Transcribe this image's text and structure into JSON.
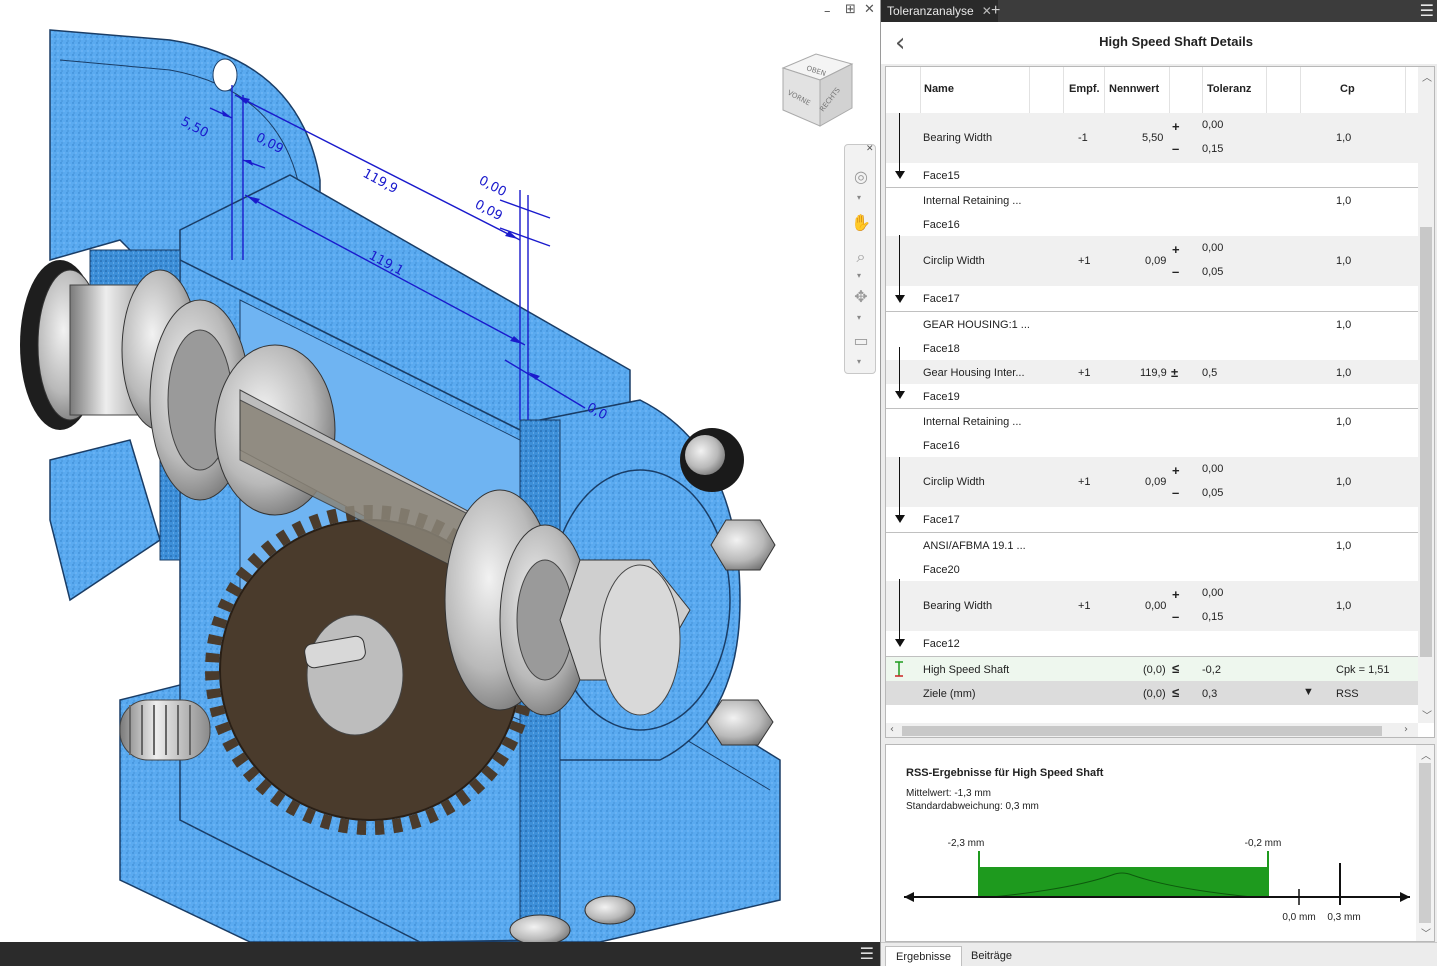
{
  "viewport": {
    "dimensions": [
      {
        "value": "5,50"
      },
      {
        "value": "0,09"
      },
      {
        "value": "119,9"
      },
      {
        "value": "119,1"
      },
      {
        "value": "0,00"
      },
      {
        "value": "0,09"
      },
      {
        "value": "0,0"
      }
    ],
    "viewcube": {
      "top": "OBEN",
      "front": "VORNE",
      "right": "RECHTS"
    },
    "nav_icons": [
      "steering-wheel-icon",
      "pan-icon",
      "zoom-icon",
      "orbit-icon",
      "look-at-icon"
    ],
    "colors": {
      "housing": "#5aaaf0",
      "housing_dark": "#2f7ec8",
      "dimension": "#1a1acc",
      "gear": "#5a4a3a",
      "metal": "#bfbfbf"
    }
  },
  "panel": {
    "tab_label": "Toleranzanalyse",
    "tab_close": "✕",
    "tab_add": "+",
    "title": "High Speed Shaft Details",
    "columns": {
      "name": "Name",
      "empf": "Empf.",
      "nennwert": "Nennwert",
      "toleranz": "Toleranz",
      "cp": "Cp"
    },
    "rows": [
      {
        "name": "Bearing Width",
        "empf": "-1",
        "nennwert": "5,50",
        "sym": "+/-",
        "tol_upper": "0,00",
        "tol_lower": "0,15",
        "cp": "1,0"
      },
      {
        "name": "Face15"
      },
      {
        "name": "Internal Retaining ...",
        "cp": "1,0"
      },
      {
        "name": "Face16"
      },
      {
        "name": "Circlip Width",
        "empf": "+1",
        "nennwert": "0,09",
        "sym": "+/-",
        "tol_upper": "0,00",
        "tol_lower": "0,05",
        "cp": "1,0"
      },
      {
        "name": "Face17"
      },
      {
        "name": "GEAR HOUSING:1 ...",
        "cp": "1,0"
      },
      {
        "name": "Face18"
      },
      {
        "name": "Gear Housing Inter...",
        "empf": "+1",
        "nennwert": "119,9",
        "sym": "±",
        "tol": "0,5",
        "cp": "1,0"
      },
      {
        "name": "Face19"
      },
      {
        "name": "Internal Retaining ...",
        "cp": "1,0"
      },
      {
        "name": "Face16"
      },
      {
        "name": "Circlip Width",
        "empf": "+1",
        "nennwert": "0,09",
        "sym": "+/-",
        "tol_upper": "0,00",
        "tol_lower": "0,05",
        "cp": "1,0"
      },
      {
        "name": "Face17"
      },
      {
        "name": "ANSI/AFBMA 19.1 ...",
        "cp": "1,0"
      },
      {
        "name": "Face20"
      },
      {
        "name": "Bearing Width",
        "empf": "+1",
        "nennwert": "0,00",
        "sym": "+/-",
        "tol_upper": "0,00",
        "tol_lower": "0,15",
        "cp": "1,0"
      },
      {
        "name": "Face12"
      }
    ],
    "summary": {
      "name": "High Speed Shaft",
      "nennwert": "(0,0)",
      "sym": "≤",
      "tol": "-0,2",
      "cp": "Cpk = 1,51"
    },
    "goals": {
      "name": "Ziele (mm)",
      "nennwert": "(0,0)",
      "sym": "≤",
      "tol": "0,3",
      "method": "RSS"
    },
    "results": {
      "title": "RSS-Ergebnisse für High Speed Shaft",
      "mean": "Mittelwert: -1,3 mm",
      "stddev": "Standardabweichung: 0,3 mm",
      "lower": "-2,3 mm",
      "upper": "-0,2 mm",
      "zero": "0,0 mm",
      "goal": "0,3 mm",
      "band_color": "#1e9a1e"
    },
    "bottom_tabs": [
      "Ergebnisse",
      "Beiträge"
    ]
  }
}
